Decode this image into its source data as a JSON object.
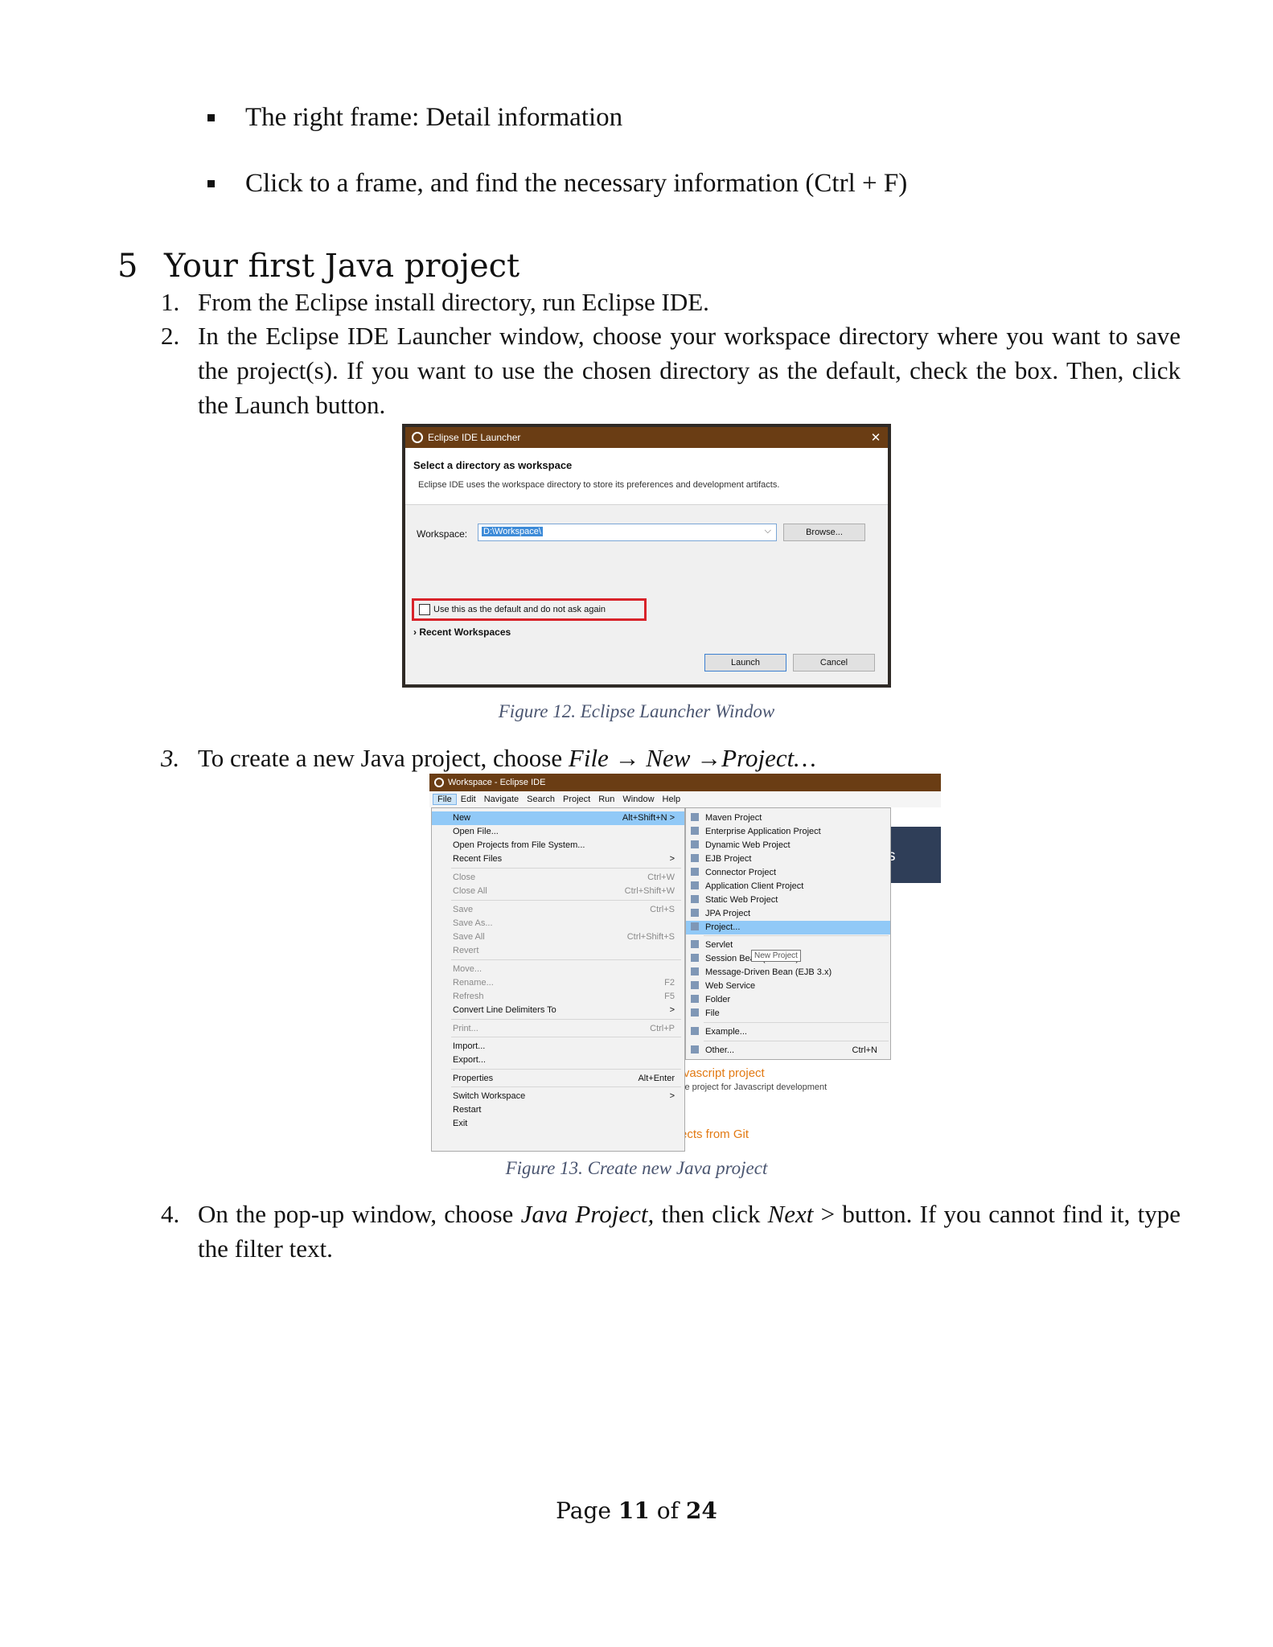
{
  "bullets": [
    "The right frame: Detail information",
    "Click to a frame, and find the necessary information (Ctrl + F)"
  ],
  "section": {
    "number": "5",
    "title": "Your first Java project"
  },
  "steps": [
    {
      "num": "1.",
      "text": "From the Eclipse install directory, run Eclipse IDE."
    },
    {
      "num": "2.",
      "text": "In the Eclipse IDE Launcher window, choose your workspace directory where you want to save the project(s). If you want to use the chosen directory as the default, check the box. Then, click the Launch button."
    },
    {
      "num": "3.",
      "text_prefix": "To create a new Java project, choose ",
      "text_italic": "File → New →Project…"
    },
    {
      "num": "4.",
      "t1": "On the pop-up window, choose ",
      "t2": "Java Project,",
      "t3": " then click ",
      "t4": "Next",
      "t5": " > button. If you cannot find it, type the filter text."
    }
  ],
  "launcher": {
    "title": "Eclipse IDE Launcher",
    "close": "✕",
    "heading": "Select a directory as workspace",
    "description": "Eclipse IDE uses the workspace directory to store its preferences and development artifacts.",
    "workspace_label": "Workspace:",
    "workspace_value": "D:\\Workspace\\",
    "browse_label": "Browse...",
    "checkbox_label": "Use this as the default and do not ask again",
    "recent_label": "Recent Workspaces",
    "launch_label": "Launch",
    "cancel_label": "Cancel",
    "highlight_color": "#d8232a"
  },
  "fig12_caption": "Figure 12. Eclipse Launcher Window",
  "ide": {
    "title": "Workspace - Eclipse IDE",
    "menubar": [
      "File",
      "Edit",
      "Navigate",
      "Search",
      "Project",
      "Run",
      "Window",
      "Help"
    ],
    "bg_panel_text": "opers",
    "bg_link1": "Javascript project",
    "bg_sub1": "se project for Javascript development",
    "bg_link2": "ects from Git",
    "file_menu": [
      {
        "label": "New",
        "shortcut": "Alt+Shift+N >",
        "state": "highlight"
      },
      {
        "label": "Open File...",
        "shortcut": "",
        "state": "normal"
      },
      {
        "label": "Open Projects from File System...",
        "shortcut": "",
        "state": "normal"
      },
      {
        "label": "Recent Files",
        "shortcut": ">",
        "state": "normal"
      },
      {
        "label": "Close",
        "shortcut": "Ctrl+W",
        "state": "disabled"
      },
      {
        "label": "Close All",
        "shortcut": "Ctrl+Shift+W",
        "state": "disabled"
      },
      {
        "label": "Save",
        "shortcut": "Ctrl+S",
        "state": "disabled"
      },
      {
        "label": "Save As...",
        "shortcut": "",
        "state": "disabled"
      },
      {
        "label": "Save All",
        "shortcut": "Ctrl+Shift+S",
        "state": "disabled"
      },
      {
        "label": "Revert",
        "shortcut": "",
        "state": "disabled"
      },
      {
        "label": "Move...",
        "shortcut": "",
        "state": "disabled"
      },
      {
        "label": "Rename...",
        "shortcut": "F2",
        "state": "disabled"
      },
      {
        "label": "Refresh",
        "shortcut": "F5",
        "state": "disabled"
      },
      {
        "label": "Convert Line Delimiters To",
        "shortcut": ">",
        "state": "normal"
      },
      {
        "label": "Print...",
        "shortcut": "Ctrl+P",
        "state": "disabled"
      },
      {
        "label": "Import...",
        "shortcut": "",
        "state": "normal"
      },
      {
        "label": "Export...",
        "shortcut": "",
        "state": "normal"
      },
      {
        "label": "Properties",
        "shortcut": "Alt+Enter",
        "state": "normal"
      },
      {
        "label": "Switch Workspace",
        "shortcut": ">",
        "state": "normal"
      },
      {
        "label": "Restart",
        "shortcut": "",
        "state": "normal"
      },
      {
        "label": "Exit",
        "shortcut": "",
        "state": "normal"
      }
    ],
    "new_submenu": [
      {
        "label": "Maven Project",
        "shortcut": "",
        "state": "normal"
      },
      {
        "label": "Enterprise Application Project",
        "shortcut": "",
        "state": "normal"
      },
      {
        "label": "Dynamic Web Project",
        "shortcut": "",
        "state": "normal"
      },
      {
        "label": "EJB Project",
        "shortcut": "",
        "state": "normal"
      },
      {
        "label": "Connector Project",
        "shortcut": "",
        "state": "normal"
      },
      {
        "label": "Application Client Project",
        "shortcut": "",
        "state": "normal"
      },
      {
        "label": "Static Web Project",
        "shortcut": "",
        "state": "normal"
      },
      {
        "label": "JPA Project",
        "shortcut": "",
        "state": "normal"
      },
      {
        "label": "Project...",
        "shortcut": "",
        "state": "highlight"
      },
      {
        "label": "Servlet",
        "shortcut": "",
        "state": "normal"
      },
      {
        "label": "Session Bean (EJB 3.x)",
        "shortcut": "",
        "state": "normal"
      },
      {
        "label": "Message-Driven Bean (EJB 3.x)",
        "shortcut": "",
        "state": "normal"
      },
      {
        "label": "Web Service",
        "shortcut": "",
        "state": "normal"
      },
      {
        "label": "Folder",
        "shortcut": "",
        "state": "normal"
      },
      {
        "label": "File",
        "shortcut": "",
        "state": "normal"
      },
      {
        "label": "Example...",
        "shortcut": "",
        "state": "normal"
      },
      {
        "label": "Other...",
        "shortcut": "Ctrl+N",
        "state": "normal"
      }
    ],
    "tooltip": "New Project"
  },
  "fig13_caption": "Figure 13. Create new Java project",
  "footer": {
    "prefix": "Page ",
    "current": "11",
    "mid": " of ",
    "total": "24"
  }
}
